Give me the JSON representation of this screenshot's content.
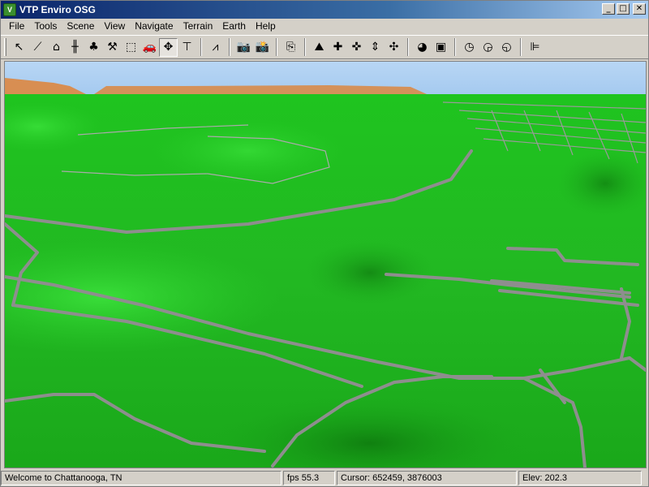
{
  "window": {
    "title": "VTP Enviro OSG",
    "app_icon": "V"
  },
  "title_buttons": {
    "minimize": "_",
    "maximize": "□",
    "close": "✕"
  },
  "menu": [
    "File",
    "Tools",
    "Scene",
    "View",
    "Navigate",
    "Terrain",
    "Earth",
    "Help"
  ],
  "toolbar": {
    "groups": [
      [
        {
          "name": "select-pointer-icon",
          "glyph": "↖"
        },
        {
          "name": "draw-fence-icon",
          "glyph": "⟋"
        },
        {
          "name": "building-icon",
          "glyph": "⌂"
        },
        {
          "name": "power-line-icon",
          "glyph": "╫"
        },
        {
          "name": "tree-icon",
          "glyph": "♣"
        },
        {
          "name": "route-icon",
          "glyph": "⚒"
        },
        {
          "name": "select-box-icon",
          "glyph": "⬚"
        },
        {
          "name": "vehicle-icon",
          "glyph": "🚗"
        },
        {
          "name": "move-icon",
          "glyph": "✥",
          "active": true
        },
        {
          "name": "measure-icon",
          "glyph": "⊤"
        }
      ],
      [
        {
          "name": "profile-icon",
          "glyph": "⩘"
        }
      ],
      [
        {
          "name": "camera-icon",
          "glyph": "📷"
        },
        {
          "name": "camera-save-icon",
          "glyph": "📸"
        }
      ],
      [
        {
          "name": "layers-icon",
          "glyph": "⎘"
        }
      ],
      [
        {
          "name": "terrain-flight-icon",
          "glyph": "⛰"
        },
        {
          "name": "speed-up-icon",
          "glyph": "✚"
        },
        {
          "name": "speed-down-icon",
          "glyph": "✜"
        },
        {
          "name": "altitude-icon",
          "glyph": "⇕"
        },
        {
          "name": "navigate-all-icon",
          "glyph": "✣"
        }
      ],
      [
        {
          "name": "earth-globe-icon",
          "glyph": "◕"
        },
        {
          "name": "earth-map-icon",
          "glyph": "▣"
        }
      ],
      [
        {
          "name": "time-icon",
          "glyph": "◷"
        },
        {
          "name": "time-play-icon",
          "glyph": "◶"
        },
        {
          "name": "time-stop-icon",
          "glyph": "◵"
        }
      ],
      [
        {
          "name": "scene-graph-icon",
          "glyph": "⊫"
        }
      ]
    ]
  },
  "status": {
    "message": "Welcome to Chattanooga, TN",
    "fps": "fps 55.3",
    "cursor": "Cursor: 652459, 3876003",
    "elev": "Elev: 202.3"
  },
  "colors": {
    "sky": "#a8ccf0",
    "terrain_bright": "#2fdc2f",
    "terrain_dark": "#0a7a0a",
    "road": "#8c8c8c",
    "mesa": "#d48a50"
  }
}
